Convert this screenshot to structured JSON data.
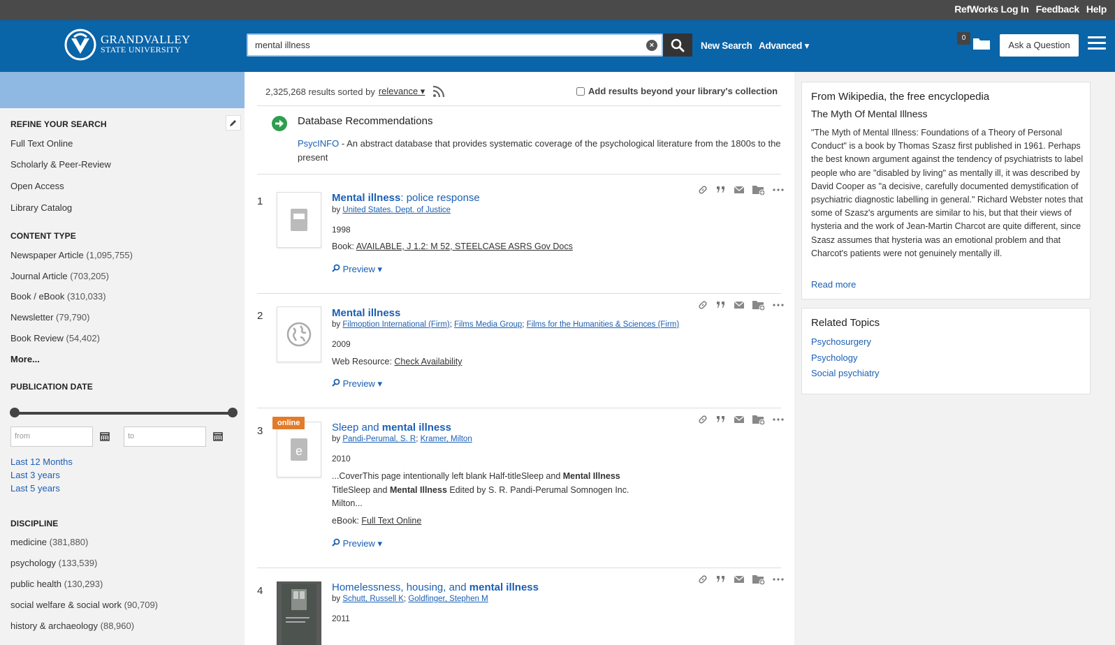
{
  "topbar": {
    "links": [
      "RefWorks Log In",
      "Feedback",
      "Help"
    ]
  },
  "header": {
    "logo_line1": "GRANDVALLEY",
    "logo_line2": "STATE UNIVERSITY",
    "search_value": "mental illness",
    "new_search": "New Search",
    "advanced": "Advanced ▾",
    "folder_count": "0",
    "ask_button": "Ask a Question"
  },
  "sidebar": {
    "refine_heading": "REFINE YOUR SEARCH",
    "refine_items": [
      "Full Text Online",
      "Scholarly & Peer-Review",
      "Open Access",
      "Library Catalog"
    ],
    "content_heading": "CONTENT TYPE",
    "content_items": [
      {
        "label": "Newspaper Article",
        "count": "(1,095,755)"
      },
      {
        "label": "Journal Article",
        "count": "(703,205)"
      },
      {
        "label": "Book / eBook",
        "count": "(310,033)"
      },
      {
        "label": "Newsletter",
        "count": "(79,790)"
      },
      {
        "label": "Book Review",
        "count": "(54,402)"
      }
    ],
    "more": "More...",
    "pubdate_heading": "PUBLICATION DATE",
    "from_placeholder": "from",
    "to_placeholder": "to",
    "date_links": [
      "Last 12 Months",
      "Last 3 years",
      "Last 5 years"
    ],
    "discipline_heading": "DISCIPLINE",
    "discipline_items": [
      {
        "label": "medicine",
        "count": "(381,880)"
      },
      {
        "label": "psychology",
        "count": "(133,539)"
      },
      {
        "label": "public health",
        "count": "(130,293)"
      },
      {
        "label": "social welfare & social work",
        "count": "(90,709)"
      },
      {
        "label": "history & archaeology",
        "count": "(88,960)"
      }
    ]
  },
  "main": {
    "results_count": "2,325,268 results sorted by",
    "sort_value": "relevance ▾",
    "beyond_label": "Add results beyond your library's collection",
    "dbrec_title": "Database Recommendations",
    "dbrec_name": "PsycINFO",
    "dbrec_desc": " - An abstract database that provides systematic coverage of the psychological literature from the 1800s to the present",
    "preview_label": "Preview ▾",
    "online_badge": "online",
    "results": [
      {
        "num": "1",
        "title_bold": "Mental illness",
        "title_rest": ": police response",
        "by": "by",
        "authors": [
          "United States. Dept. of Justice"
        ],
        "year": "1998",
        "avail_type": "Book:",
        "avail_link": "AVAILABLE, J 1.2: M 52, STEELCASE ASRS Gov Docs"
      },
      {
        "num": "2",
        "title_bold": "Mental illness",
        "title_rest": "",
        "by": "by",
        "authors": [
          "Filmoption International (Firm)",
          "Films Media Group",
          "Films for the Humanities & Sciences (Firm)"
        ],
        "year": "2009",
        "avail_type": "Web Resource:",
        "avail_link": "Check Availability"
      },
      {
        "num": "3",
        "title_pre": "Sleep and ",
        "title_bold": "mental illness",
        "by": "by",
        "authors": [
          "Pandi-Perumal, S. R",
          "Kramer, Milton"
        ],
        "year": "2010",
        "snippet": [
          {
            "t": "...CoverThis page intentionally left blank Half-titleSleep and ",
            "b": false
          },
          {
            "t": "Mental Illness",
            "b": true
          },
          {
            "t": " TitleSleep and ",
            "b": false
          },
          {
            "t": "Mental Illness",
            "b": true
          },
          {
            "t": " Edited by S. R. Pandi-Perumal Somnogen Inc. Milton...",
            "b": false
          }
        ],
        "avail_type": "eBook:",
        "avail_link": "Full Text Online"
      },
      {
        "num": "4",
        "title_pre": "Homelessness, housing, and ",
        "title_bold": "mental illness",
        "by": "by",
        "authors": [
          "Schutt, Russell K",
          "Goldfinger, Stephen M"
        ],
        "year": "2011"
      }
    ]
  },
  "wiki": {
    "heading": "From Wikipedia, the free encyclopedia",
    "title": "The Myth Of Mental Illness",
    "body": "\"The Myth of Mental Illness: Foundations of a Theory of Personal Conduct\" is a book by Thomas Szasz first published in 1961. Perhaps the best known argument against the tendency of psychiatrists to label people who are \"disabled by living\" as mentally ill, it was described by David Cooper as \"a decisive, carefully documented demystification of psychiatric diagnostic labelling in general.\" Richard Webster notes that some of Szasz's arguments are similar to his, but that their views of hysteria and the work of Jean-Martin Charcot are quite different, since Szasz assumes that hysteria was an emotional problem and that Charcot's patients were not genuinely mentally ill.",
    "read_more": "Read more"
  },
  "related": {
    "heading": "Related Topics",
    "items": [
      "Psychosurgery",
      "Psychology",
      "Social psychiatry"
    ]
  },
  "colors": {
    "header_blue": "#0a64a8",
    "topbar": "#4a4a4a",
    "link_blue": "#1a5fb4",
    "online_orange": "#e27b2a"
  }
}
